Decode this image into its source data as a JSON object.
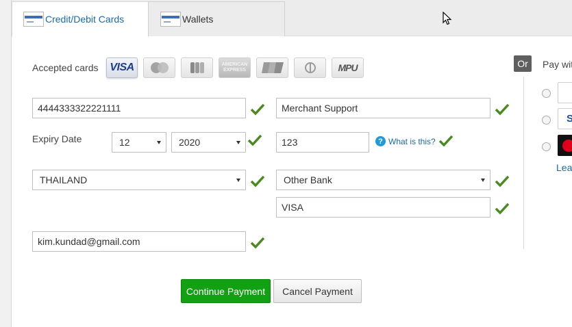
{
  "tabs": {
    "cards_label": "Credit/Debit Cards",
    "wallets_label": "Wallets"
  },
  "form": {
    "accepted_cards_label": "Accepted cards",
    "card_brands": [
      "VISA",
      "MasterCard",
      "JCB",
      "American Express",
      "UnionPay",
      "Diners Club",
      "MPU"
    ],
    "amex_text": "AMERICAN EXPRESS",
    "card_number": "4444333322221111",
    "card_holder": "Merchant Support",
    "expiry_label": "Expiry Date",
    "expiry_month": "12",
    "expiry_year": "2020",
    "cvv": "123",
    "help_link": "What is this?",
    "country": "THAILAND",
    "issuing_bank": "Other Bank",
    "bank_name": "VISA",
    "email": "kim.kundad@gmail.com"
  },
  "buttons": {
    "continue": "Continue Payment",
    "cancel": "Cancel Payment"
  },
  "alt_pay": {
    "or_label": "Or",
    "pay_with_label": "Pay wit",
    "learn_label": "Lea"
  },
  "colors": {
    "accent_blue": "#1a6aa8",
    "continue_green": "#12a112",
    "check_green": "#4a8a1e"
  }
}
